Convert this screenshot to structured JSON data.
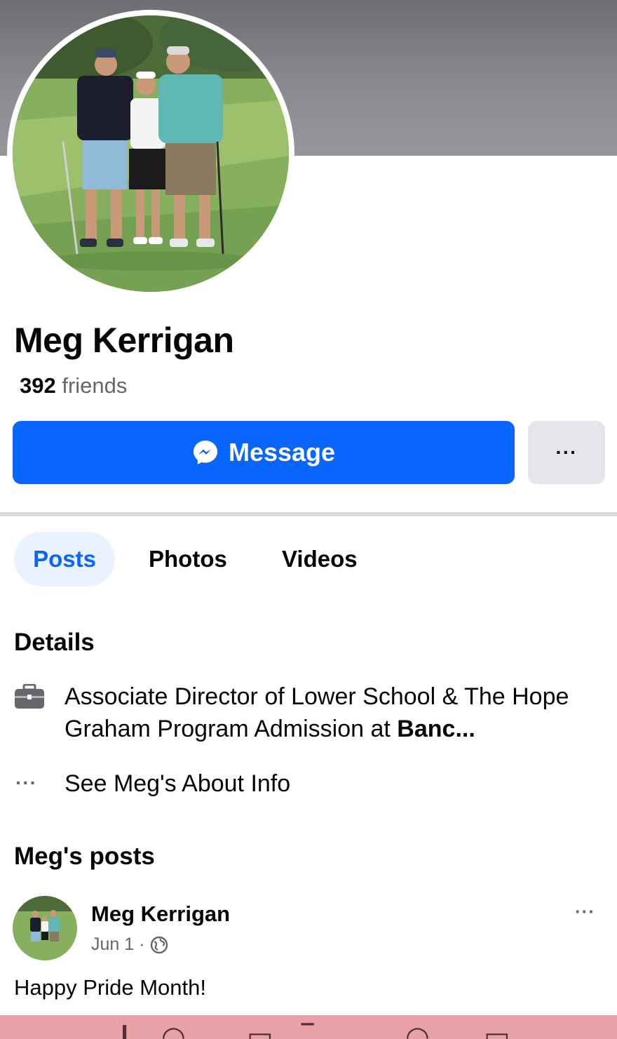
{
  "profile": {
    "name": "Meg Kerrigan",
    "friends_count": "392",
    "friends_label": " friends"
  },
  "actions": {
    "message_label": "Message",
    "more_label": "···"
  },
  "tabs": [
    {
      "label": "Posts",
      "active": true
    },
    {
      "label": "Photos",
      "active": false
    },
    {
      "label": "Videos",
      "active": false
    }
  ],
  "details": {
    "title": "Details",
    "work_text": "Associate Director of Lower School & The Hope Graham Program Admission at ",
    "work_org": "Banc...",
    "about_icon": "···",
    "about_link": "See Meg's About Info"
  },
  "posts_section": {
    "title": "Meg's posts",
    "post": {
      "author": "Meg Kerrigan",
      "date": "Jun 1 ·",
      "audience_icon": "globe-icon",
      "menu_label": "···",
      "text": "Happy Pride Month!"
    }
  },
  "colors": {
    "accent": "#0866ff",
    "tab_active_bg": "#ebf2ff",
    "secondary_button": "#e4e6eb",
    "muted_text": "#65676b"
  }
}
